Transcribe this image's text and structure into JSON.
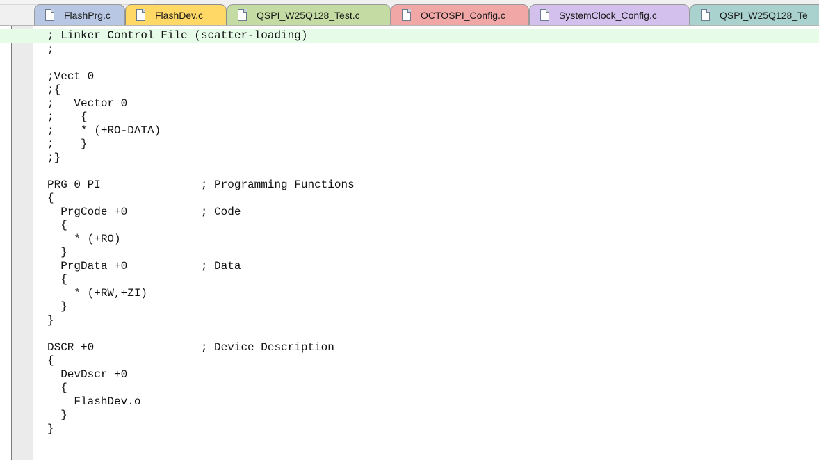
{
  "tabs": [
    {
      "label": "FlashPrg.c",
      "color": "#b8c7e4",
      "icon": "file-icon"
    },
    {
      "label": "FlashDev.c",
      "color": "#ffd866",
      "icon": "file-icon",
      "active": true
    },
    {
      "label": "QSPI_W25Q128_Test.c",
      "color": "#c4dca4",
      "icon": "file-icon"
    },
    {
      "label": "OCTOSPI_Config.c",
      "color": "#f2a7a7",
      "icon": "file-icon"
    },
    {
      "label": "SystemClock_Config.c",
      "color": "#d4c0ec",
      "icon": "file-icon"
    },
    {
      "label": "QSPI_W25Q128_Te",
      "color": "#a9d2cf",
      "icon": "file-icon"
    }
  ],
  "editor": {
    "current_line_color": "#e6fbe8",
    "lines": [
      "; Linker Control File (scatter-loading)",
      ";",
      "",
      ";Vect 0",
      ";{",
      ";   Vector 0",
      ";    {",
      ";    * (+RO-DATA)",
      ";    }",
      ";}",
      "",
      "PRG 0 PI               ; Programming Functions",
      "{",
      "  PrgCode +0           ; Code",
      "  {",
      "    * (+RO)",
      "  }",
      "  PrgData +0           ; Data",
      "  {",
      "    * (+RW,+ZI)",
      "  }",
      "}",
      "",
      "DSCR +0                ; Device Description",
      "{",
      "  DevDscr +0",
      "  {",
      "    FlashDev.o",
      "  }",
      "}",
      ""
    ]
  }
}
